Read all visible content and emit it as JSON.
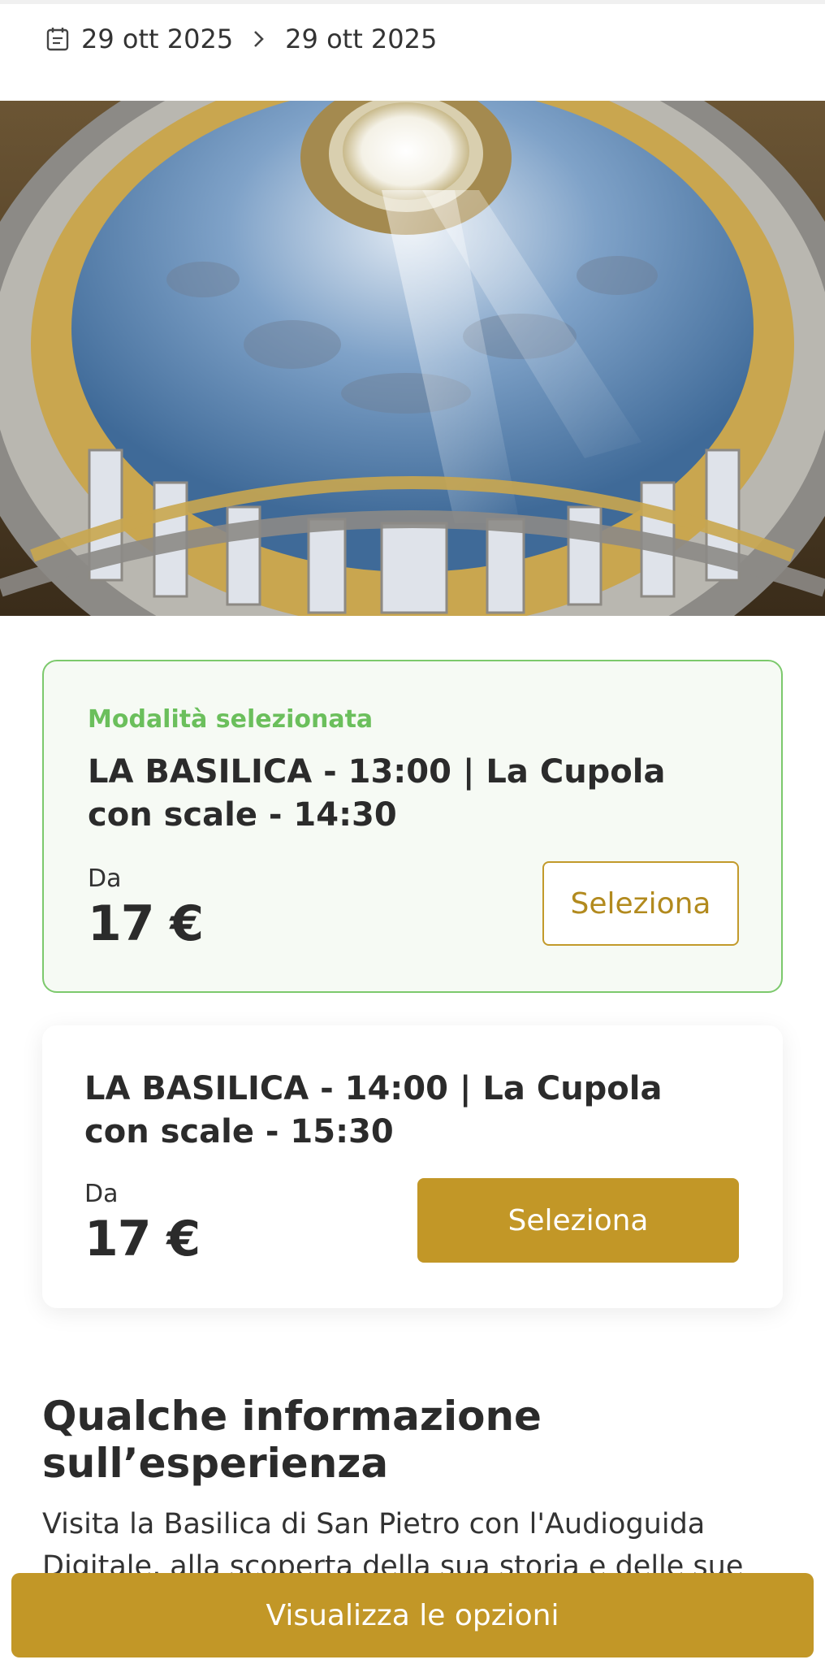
{
  "dates": {
    "start": "29 ott 2025",
    "end": "29 ott 2025"
  },
  "icons": {
    "calendar": "calendar-icon",
    "arrow": "chevron-right-icon"
  },
  "options": [
    {
      "selected_label": "Modalità selezionata",
      "title": "LA BASILICA - 13:00 | La Cupola con scale - 14:30",
      "from_label": "Da",
      "price": "17 €",
      "button_label": "Seleziona"
    },
    {
      "title": "LA BASILICA - 14:00 | La Cupola con scale - 15:30",
      "from_label": "Da",
      "price": "17 €",
      "button_label": "Seleziona"
    }
  ],
  "info": {
    "title": "Qualche informazione sull’esperienza",
    "text": "Visita la Basilica di San Pietro con l'Audioguida Digitale, alla scoperta della sua storia e delle sue"
  },
  "footer": {
    "cta_label": "Visualizza le opzioni"
  },
  "colors": {
    "accent_gold": "#c29727",
    "selected_green": "#6bbf5c"
  }
}
